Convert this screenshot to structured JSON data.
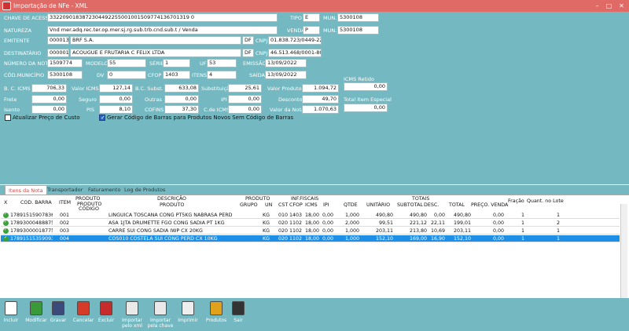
{
  "window": {
    "title": "Importação de NFe - XML",
    "min_glyph": "–",
    "max_glyph": "□",
    "close_glyph": "✕"
  },
  "header": {
    "chave_label": "CHAVE DE ACESSO",
    "chave_value": "3322090183872304492255001001509774136701319 0",
    "tipo_label": "TIPO",
    "tipo_value": "E",
    "mun_label": "MUN.",
    "mun_value": "5300108",
    "natureza_label": "NATUREZA",
    "natureza_value": "Vnd mer.adq.rec.ter.op.mer.sj.rg.sub.trb.cnd.sub.t / Venda",
    "venda_label": "VENDA",
    "venda_value": "P",
    "mun2_label": "MUN.",
    "mun2_value": "5300108",
    "emitente_label": "EMITENTE",
    "emitente_code": "000013",
    "emitente_name": "BRF S.A.",
    "emitente_df": "DF",
    "cnpj_label": "CNPJ",
    "emitente_cnpj": "01.838.723/0449-22",
    "destinatario_label": "DESTINATÁRIO",
    "destinatario_code": "000001",
    "destinatario_name": "ACOUGUE E FRUTARIA C FELIX LTDA",
    "destinatario_df": "DF",
    "cnpj2_label": "CNPJ",
    "destinatario_cnpj": "46.513.468/0001-80",
    "numero_label": "NÚMERO DA NOTA",
    "numero_value": "1509774",
    "modelo_label": "MODELO",
    "modelo_value": "55",
    "serie_label": "SÉRIE",
    "serie_value": "1",
    "uf_label": "UF",
    "uf_value": "53",
    "emissao_label": "EMISSÃO",
    "emissao_value": "13/09/2022",
    "codmun_label": "CÓD.MUNICÍPIO",
    "codmun_value": "5300108",
    "dv_label": "DV",
    "dv_value": "0",
    "cfop_label": "CFOP",
    "cfop_value": "1403",
    "itens_label": "ITENS",
    "itens_value": "4",
    "saida_label": "SAÍDA",
    "saida_value": "13/09/2022"
  },
  "totals": {
    "bc_icms_label": "B. C. ICMS",
    "bc_icms": "706,33",
    "valor_icms_label": "Valor ICMS",
    "valor_icms": "127,14",
    "bc_subst_label": "B.C. Subst.",
    "bc_subst": "633,08",
    "substituicao_label": "Substituição",
    "substituicao": "25,61",
    "valor_produtos_label": "Valor Produtos",
    "valor_produtos": "1.094,72",
    "icms_retido_label": "ICMS Retido",
    "icms_retido": "0,00",
    "frete_label": "Frete",
    "frete": "0,00",
    "seguro_label": "Seguro",
    "seguro": "0,00",
    "outras_label": "Outras",
    "outras": "0,00",
    "ipi_label": "IPI",
    "ipi": "0,00",
    "desconto_label": "Desconto",
    "desconto": "49,70",
    "total_item_especial_label": "Total Item Especial",
    "total_item_especial": "0,00",
    "isento_label": "Isento",
    "isento": "0,00",
    "pis_label": "PIS",
    "pis": "8,10",
    "cofins_label": "COFINS",
    "cofins": "37,30",
    "c_icms_label": "C.de ICMS",
    "c_icms": "0,00",
    "valor_nota_label": "Valor da Nota",
    "valor_nota": "1.070,63"
  },
  "options": {
    "atualizar_label": "Atualizar Preço de Custo",
    "atualizar_checked": false,
    "gerar_label": "Gerar Código de Barras para Produtos Novos Sem Código de Barras",
    "gerar_checked": true
  },
  "tabs": [
    "Itens da Nota",
    "Transportador",
    "Faturamento",
    "Log de Produtos"
  ],
  "grid": {
    "groups": {
      "produto": "PRODUTO",
      "descricao": "DESCRIÇÃO",
      "produto2": "PRODUTO",
      "inf_fiscais": "INF.FISCAIS",
      "totais": "TOTAIS"
    },
    "columns": [
      "X",
      "COD. BARRA",
      "ITEM",
      "PRODUTO CÓDIGO",
      "PRODUTO",
      "GRUPO",
      "UN",
      "CST",
      "CFOP",
      "ICMS",
      "IPI",
      "QTDE",
      "UNITÁRIO",
      "SUBTOTAL",
      "DESC.",
      "TOTAL",
      "PREÇO. VENDA",
      "Fração",
      "Quant. no Lote"
    ],
    "col_produto_top": "PRODUTO",
    "col_produto_bottom": "CÓDIGO",
    "rows": [
      {
        "barra": "17891515907836",
        "item": "001",
        "codigo": "",
        "produto": "LINGUICA TOSCANA CONG PT5KG NABRASA PERD",
        "grupo": "",
        "un": "KG",
        "cst": "010",
        "cfop": "1403",
        "icms": "18,00",
        "ipi": "0,00",
        "qtde": "1,000",
        "unitario": "490,80",
        "subtotal": "490,80",
        "desc": "0,00",
        "total": "490,80",
        "preco": "0,00",
        "fracao": "1",
        "lote": "1"
      },
      {
        "barra": "17893000488875",
        "item": "002",
        "codigo": "",
        "produto": "ASA 1JTA DRUMETTE FGO CONG SADIA PT 1KG",
        "grupo": "",
        "un": "KG",
        "cst": "020",
        "cfop": "1102",
        "icms": "18,00",
        "ipi": "0,00",
        "qtde": "2,000",
        "unitario": "99,51",
        "subtotal": "221,12",
        "desc": "22,11",
        "total": "199,01",
        "preco": "0,00",
        "fracao": "1",
        "lote": "2"
      },
      {
        "barra": "17893000018775",
        "item": "003",
        "codigo": "",
        "produto": "CARRE SUI CONG SADIA IWP CX 20KG",
        "grupo": "",
        "un": "KG",
        "cst": "020",
        "cfop": "1102",
        "icms": "18,00",
        "ipi": "0,00",
        "qtde": "1,000",
        "unitario": "203,11",
        "subtotal": "213,80",
        "desc": "10,69",
        "total": "203,11",
        "preco": "0,00",
        "fracao": "1",
        "lote": "1"
      },
      {
        "barra": "17891515359093",
        "item": "004",
        "codigo": "",
        "produto": "COS010 COSTELA SUI CONG PERD CX 10KG",
        "grupo": "",
        "un": "KG",
        "cst": "020",
        "cfop": "1102",
        "icms": "18,00",
        "ipi": "0,00",
        "qtde": "1,000",
        "unitario": "152,10",
        "subtotal": "169,00",
        "desc": "16,90",
        "total": "152,10",
        "preco": "0,00",
        "fracao": "1",
        "lote": "1"
      }
    ]
  },
  "toolbar": [
    {
      "label": "Incluir",
      "icon": "document-add-icon",
      "color": "#ffffff"
    },
    {
      "label": "Modificar",
      "icon": "document-edit-icon",
      "color": "#3a9a3a"
    },
    {
      "label": "Gravar",
      "icon": "usb-drive-icon",
      "color": "#3b4a7a"
    },
    {
      "label": "Cancelar",
      "icon": "cancel-icon",
      "color": "#d63b2a"
    },
    {
      "label": "Excluir",
      "icon": "trash-icon",
      "color": "#c62c2c"
    },
    {
      "label": "Importar pelo xml",
      "icon": "import-xml-icon",
      "color": "#e9e9e9"
    },
    {
      "label": "Importar pela chave",
      "icon": "import-key-icon",
      "color": "#e9e9e9"
    },
    {
      "label": "Imprimir",
      "icon": "printer-icon",
      "color": "#eeeeee"
    },
    {
      "label": "Produtos",
      "icon": "products-box-icon",
      "color": "#e0a11b"
    },
    {
      "label": "Sair",
      "icon": "exit-icon",
      "color": "#333333"
    }
  ]
}
